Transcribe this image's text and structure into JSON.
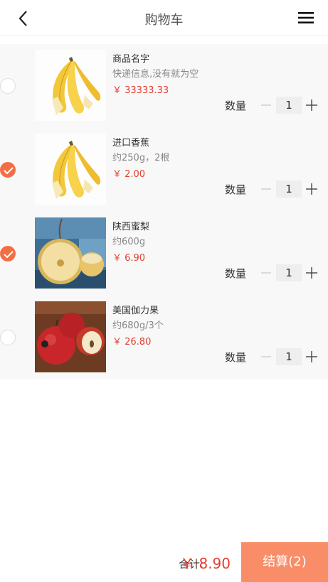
{
  "header": {
    "title": "购物车"
  },
  "items": [
    {
      "name": "商品名字",
      "desc": "快递信息,没有就为空",
      "price": "￥ 33333.33",
      "qty_label": "数量",
      "qty": "1",
      "checked": false,
      "image": "banana"
    },
    {
      "name": "进口香蕉",
      "desc": "约250g，2根",
      "price": "￥ 2.00",
      "qty_label": "数量",
      "qty": "1",
      "checked": true,
      "image": "banana"
    },
    {
      "name": "陕西蜜梨",
      "desc": "约600g",
      "price": "￥ 6.90",
      "qty_label": "数量",
      "qty": "1",
      "checked": true,
      "image": "pear"
    },
    {
      "name": "美国伽力果",
      "desc": "约680g/3个",
      "price": "￥ 26.80",
      "qty_label": "数量",
      "qty": "1",
      "checked": false,
      "image": "apple"
    }
  ],
  "footer": {
    "total_label": "合计:",
    "total_value": "￥ 8.90",
    "checkout_label": "结算(2)"
  },
  "colors": {
    "accent": "#f46e45",
    "price": "#e53e2e",
    "checkout_bg": "#f98d67"
  }
}
